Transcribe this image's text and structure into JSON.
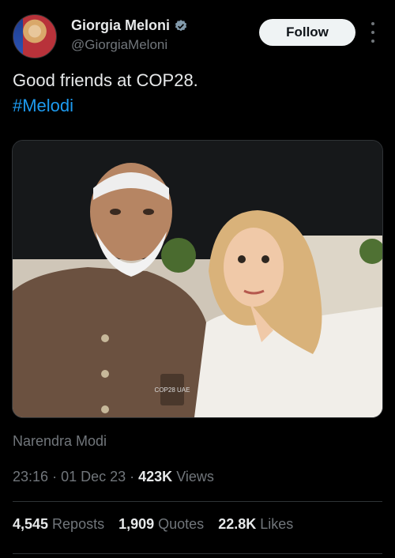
{
  "author": {
    "name": "Giorgia Meloni",
    "handle": "@GiorgiaMeloni",
    "verified_icon": "verified-badge-icon",
    "accent": "#1d9bf0"
  },
  "follow_label": "Follow",
  "post": {
    "text": "Good friends at COP28.",
    "hashtag": "#Melodi"
  },
  "media": {
    "badge_text": "COP28 UAE"
  },
  "caption": "Narendra Modi",
  "meta": {
    "time": "23:16",
    "date": "01 Dec 23",
    "views_count": "423K",
    "views_label": "Views"
  },
  "stats": {
    "reposts_count": "4,545",
    "reposts_label": "Reposts",
    "quotes_count": "1,909",
    "quotes_label": "Quotes",
    "likes_count": "22.8K",
    "likes_label": "Likes"
  }
}
